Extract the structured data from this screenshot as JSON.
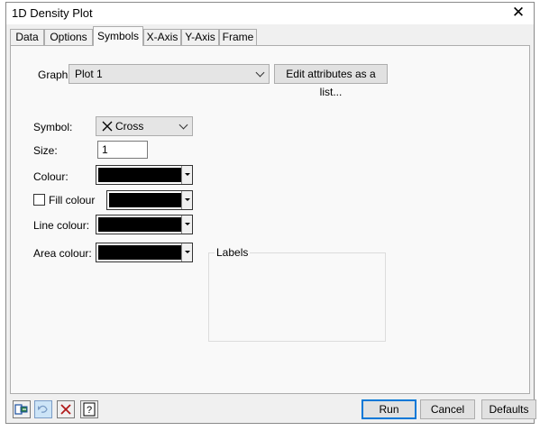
{
  "window": {
    "title": "1D Density Plot",
    "close_label": "✕"
  },
  "tabs": [
    {
      "label": "Data"
    },
    {
      "label": "Options"
    },
    {
      "label": "Symbols"
    },
    {
      "label": "X-Axis"
    },
    {
      "label": "Y-Axis"
    },
    {
      "label": "Frame"
    }
  ],
  "active_tab": "Symbols",
  "graph": {
    "label": "Graph:",
    "value": "Plot 1",
    "edit_button": "Edit attributes as a list..."
  },
  "symbol": {
    "label": "Symbol:",
    "value": "Cross",
    "icon": "cross-icon"
  },
  "size": {
    "label": "Size:",
    "value": "1"
  },
  "colour": {
    "label": "Colour:",
    "value": "#000000"
  },
  "fill_colour": {
    "label": "Fill colour",
    "checked": false,
    "value": "#000000"
  },
  "line_colour": {
    "label": "Line colour:",
    "value": "#000000"
  },
  "area_colour": {
    "label": "Area colour:",
    "value": "#000000"
  },
  "labels_group": {
    "label": "Labels"
  },
  "footer": {
    "icons": [
      "open-icon",
      "undo-icon",
      "clear-icon",
      "help-icon"
    ],
    "run": "Run",
    "cancel": "Cancel",
    "defaults": "Defaults"
  },
  "colors": {
    "accent": "#0078d7",
    "panel": "#f9f9f9",
    "window": "#f0f0f0"
  }
}
